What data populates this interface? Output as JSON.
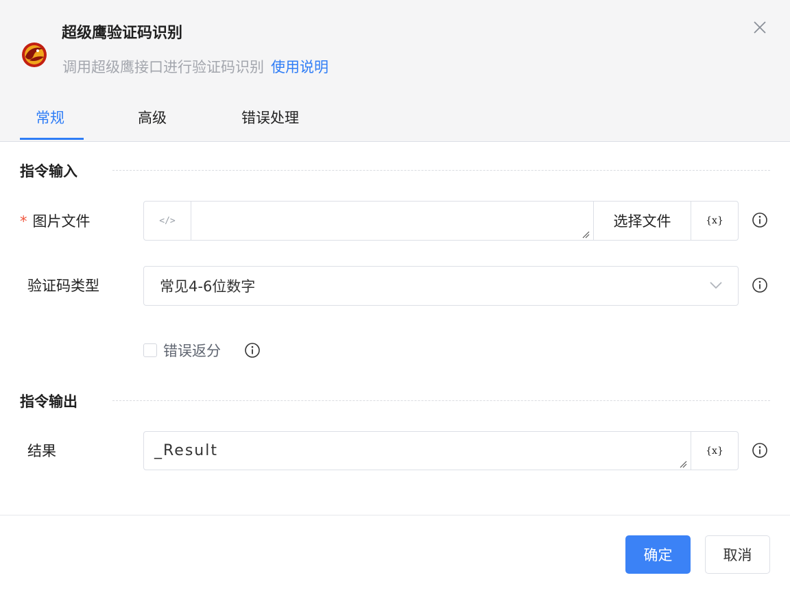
{
  "header": {
    "title": "超级鹰验证码识别",
    "subtitle": "调用超级鹰接口进行验证码识别",
    "help_link": "使用说明"
  },
  "tabs": [
    {
      "label": "常规",
      "active": true
    },
    {
      "label": "高级",
      "active": false
    },
    {
      "label": "错误处理",
      "active": false
    }
  ],
  "input_section": {
    "title": "指令输入",
    "image_file": {
      "required_mark": "*",
      "label": "图片文件",
      "value": "",
      "code_icon": "</>",
      "choose_button": "选择文件",
      "variable_button": "{x}"
    },
    "captcha_type": {
      "label": "验证码类型",
      "selected": "常见4-6位数字"
    },
    "error_refund": {
      "label": "错误返分",
      "checked": false
    }
  },
  "output_section": {
    "title": "指令输出",
    "result": {
      "label": "结果",
      "value": "_Result",
      "variable_button": "{x}"
    }
  },
  "footer": {
    "confirm": "确定",
    "cancel": "取消"
  },
  "colors": {
    "accent": "#2f7df6",
    "primary_button": "#3b82f6",
    "required": "#f0553d",
    "header_bg": "#f5f5f6"
  }
}
